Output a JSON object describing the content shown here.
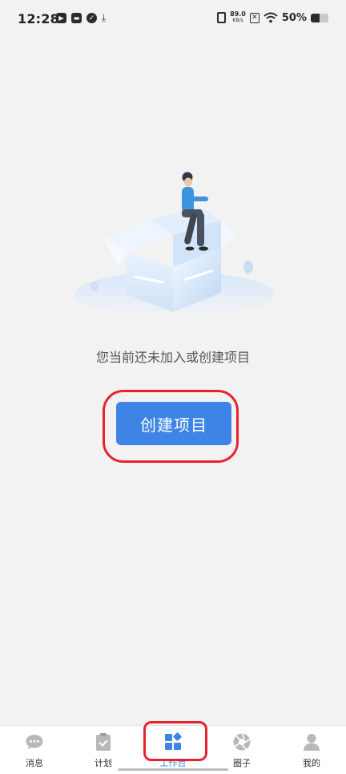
{
  "status_bar": {
    "time": "12:28",
    "net_speed_value": "89.0",
    "net_speed_unit": "KB/s",
    "battery_percent": "50%",
    "battery_level": 0.5
  },
  "main": {
    "empty_message": "您当前还未加入或创建项目",
    "create_button_label": "创建项目"
  },
  "bottom_nav": {
    "items": [
      {
        "label": "消息",
        "icon": "chat-bubble-icon"
      },
      {
        "label": "计划",
        "icon": "clipboard-check-icon"
      },
      {
        "label": "工作台",
        "icon": "workbench-grid-icon",
        "active": true
      },
      {
        "label": "圈子",
        "icon": "aperture-icon"
      },
      {
        "label": "我的",
        "icon": "user-icon"
      }
    ]
  },
  "colors": {
    "accent": "#3e84e6",
    "annotation": "#e8222d",
    "inactive_icon": "#b8b8b8"
  }
}
